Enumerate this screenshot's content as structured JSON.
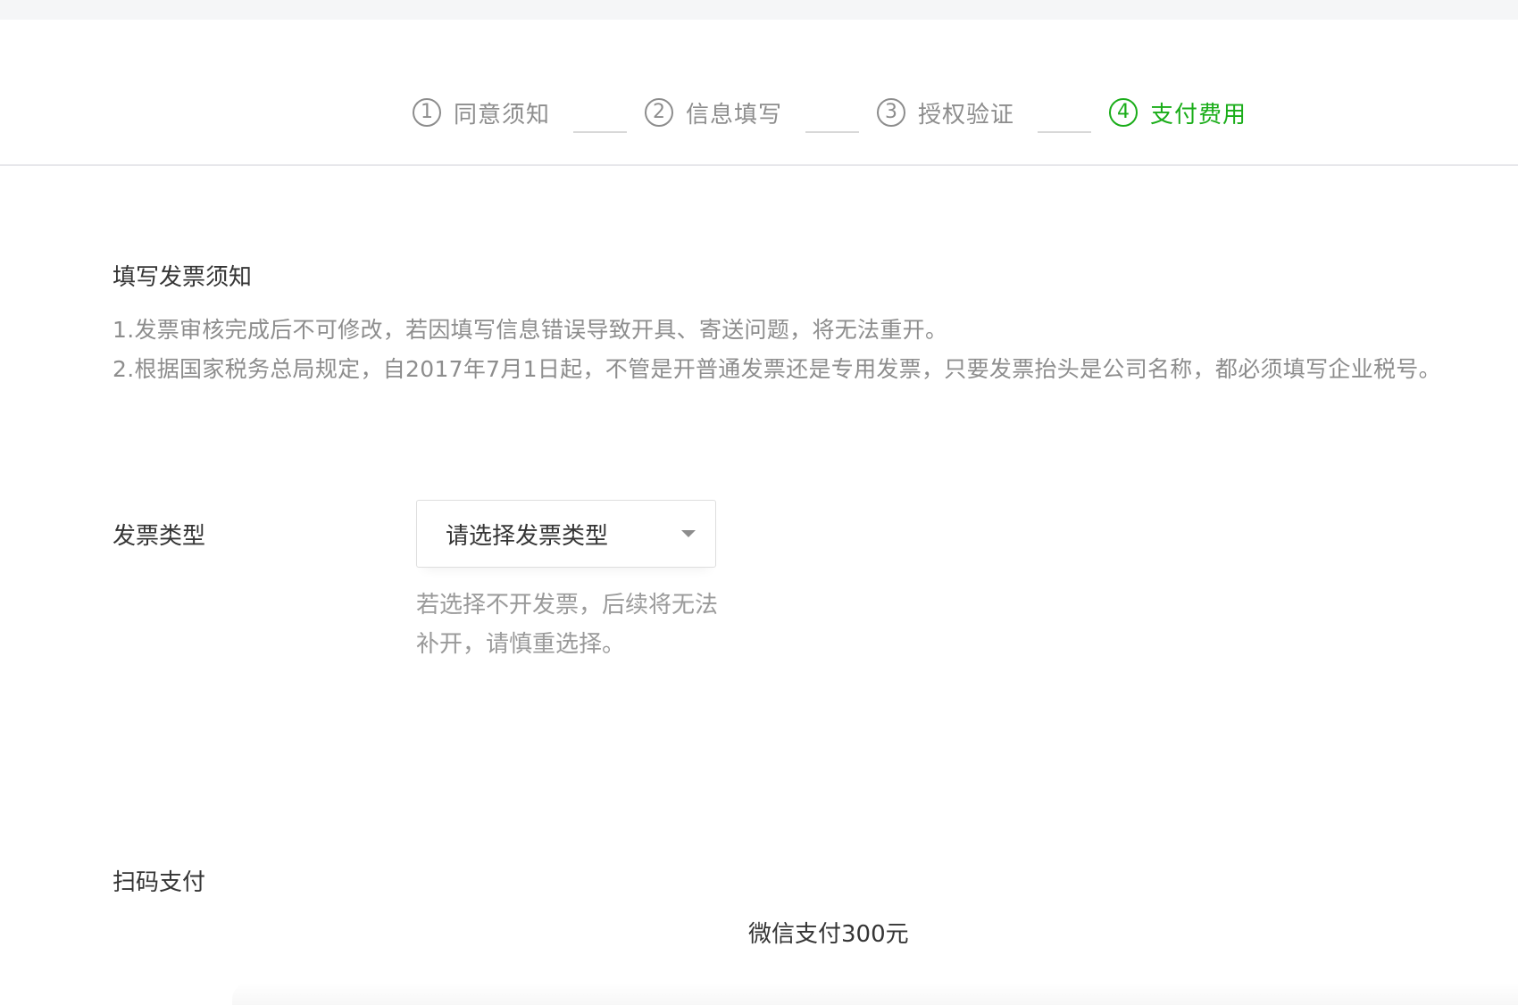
{
  "steps": [
    {
      "num": "1",
      "label": "同意须知",
      "active": false
    },
    {
      "num": "2",
      "label": "信息填写",
      "active": false
    },
    {
      "num": "3",
      "label": "授权验证",
      "active": false
    },
    {
      "num": "4",
      "label": "支付费用",
      "active": true
    }
  ],
  "colors": {
    "accent": "#1aad19",
    "muted": "#8d8d8d",
    "text": "#353535"
  },
  "notice": {
    "title": "填写发票须知",
    "line1": "1.发票审核完成后不可修改，若因填写信息错误导致开具、寄送问题，将无法重开。",
    "line2": "2.根据国家税务总局规定，自2017年7月1日起，不管是开普通发票还是专用发票，只要发票抬头是公司名称，都必须填写企业税号。"
  },
  "invoice": {
    "label": "发票类型",
    "placeholder": "请选择发票类型",
    "tip": "若选择不开发票，后续将无法补开，请慎重选择。"
  },
  "payment": {
    "label": "扫码支付",
    "amount_text": "微信支付300元"
  }
}
